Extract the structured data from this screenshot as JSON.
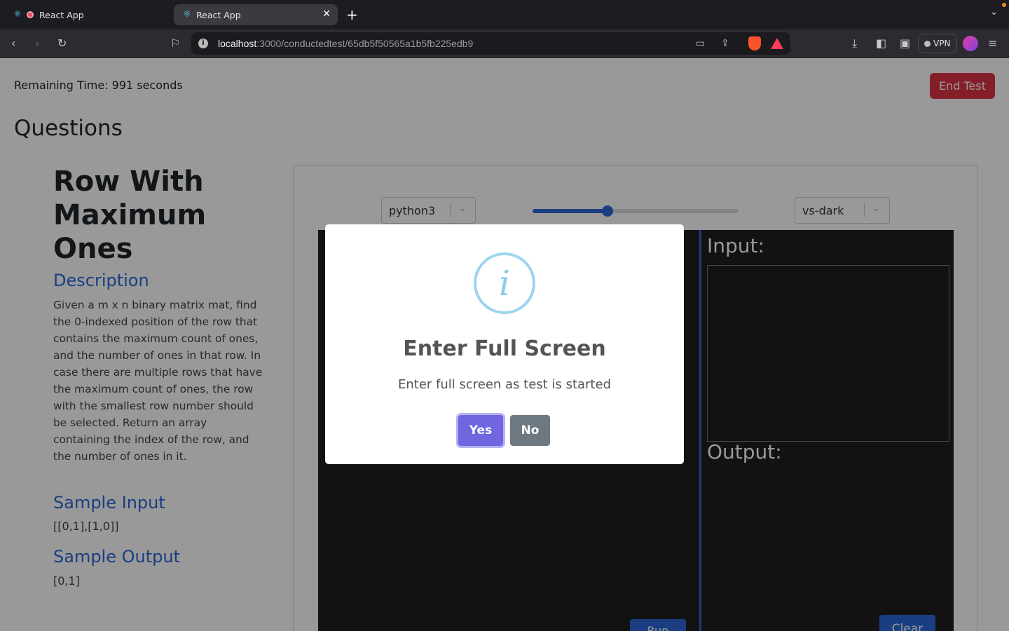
{
  "browser": {
    "tabs": [
      {
        "title": "React App"
      },
      {
        "title": "React App"
      }
    ],
    "url_host": "localhost",
    "url_path": ":3000/conductedtest/65db5f50565a1b5fb225edb9",
    "vpn_label": "VPN",
    "new_tab_glyph": "+",
    "close_glyph": "✕"
  },
  "header": {
    "remaining_time": "Remaining Time: 991 seconds",
    "end_test_label": "End Test"
  },
  "questions_heading": "Questions",
  "question": {
    "title": "Row With Maximum Ones",
    "description_heading": "Description",
    "description": "Given a m x n binary matrix mat, find the 0-indexed position of the row that contains the maximum count of ones, and the number of ones in that row. In case there are multiple rows that have the maximum count of ones, the row with the smallest row number should be selected. Return an array containing the index of the row, and the number of ones in it.",
    "sample_input_heading": "Sample Input",
    "sample_input": "[[0,1],[1,0]]",
    "sample_output_heading": "Sample Output",
    "sample_output": "[0,1]"
  },
  "editor": {
    "language": "python3",
    "theme": "vs-dark",
    "font_size_slider_fraction": 0.36,
    "input_label": "Input:",
    "output_label": "Output:",
    "run_label": "Run",
    "clear_label": "Clear"
  },
  "modal": {
    "icon": "info-icon",
    "title": "Enter Full Screen",
    "text": "Enter full screen as test is started",
    "yes_label": "Yes",
    "no_label": "No",
    "info_glyph": "i"
  },
  "colors": {
    "primary": "#2c68d8",
    "danger": "#dc3545",
    "confirm": "#7066e0",
    "cancel": "#6e7881"
  }
}
